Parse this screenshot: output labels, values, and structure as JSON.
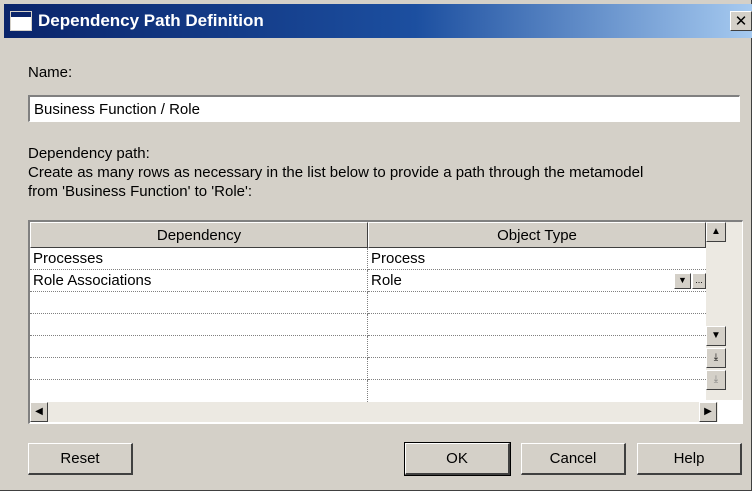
{
  "window": {
    "title": "Dependency Path Definition",
    "close_label": "✕"
  },
  "form": {
    "name_label": "Name:",
    "name_value": "Business Function / Role",
    "path_label": "Dependency path:",
    "instructions_line1": "Create as many rows as necessary in the list below to provide a path through the metamodel",
    "instructions_line2": "from 'Business Function' to 'Role':"
  },
  "grid": {
    "columns": [
      "Dependency",
      "Object Type"
    ],
    "rows": [
      {
        "dependency": "Processes",
        "object_type": "Process"
      },
      {
        "dependency": "Role Associations",
        "object_type": "Role"
      }
    ],
    "dropdown_glyph": "▼",
    "ellipsis_glyph": "..."
  },
  "scroll": {
    "up": "▲",
    "down": "▼",
    "page_down": "⤓",
    "page_up_disabled": "⤓",
    "left": "◀",
    "right": "▶"
  },
  "buttons": {
    "reset": "Reset",
    "ok": "OK",
    "cancel": "Cancel",
    "help": "Help"
  },
  "icons": {
    "title": "dialog-window-icon",
    "close": "close-icon",
    "dropdown": "chevron-down-icon",
    "browse": "ellipsis-icon"
  }
}
